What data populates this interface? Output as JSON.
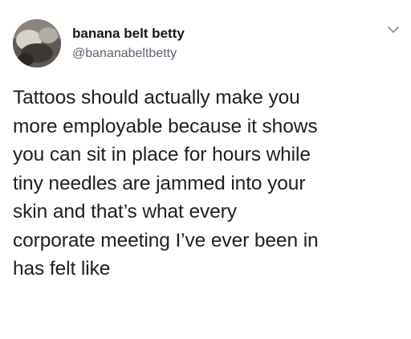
{
  "tweet": {
    "display_name": "banana belt betty",
    "handle": "@bananabeltbetty",
    "text": "Tattoos should actually make you\nmore employable because it shows\nyou can sit in place for hours while\ntiny needles are jammed into your\nskin and that’s what every\ncorporate meeting I’ve ever been in\nhas felt like",
    "icons": {
      "avatar": "avatar-photo",
      "menu": "chevron-down-icon"
    }
  }
}
